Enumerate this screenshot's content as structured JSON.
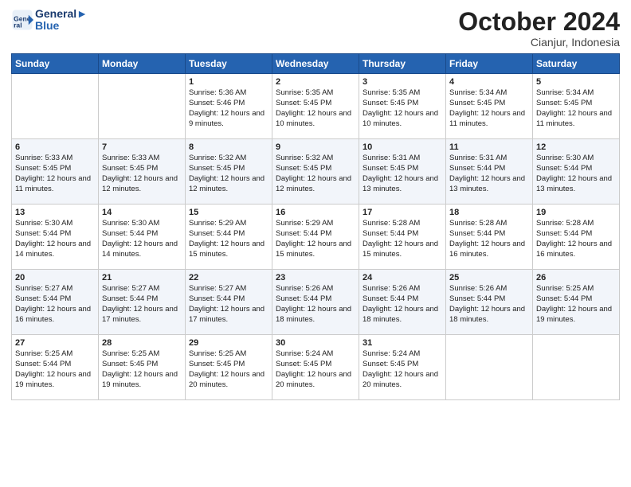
{
  "header": {
    "logo_line1": "General",
    "logo_line2": "Blue",
    "month": "October 2024",
    "location": "Cianjur, Indonesia"
  },
  "days_of_week": [
    "Sunday",
    "Monday",
    "Tuesday",
    "Wednesday",
    "Thursday",
    "Friday",
    "Saturday"
  ],
  "weeks": [
    [
      {
        "day": "",
        "sunrise": "",
        "sunset": "",
        "daylight": ""
      },
      {
        "day": "",
        "sunrise": "",
        "sunset": "",
        "daylight": ""
      },
      {
        "day": "1",
        "sunrise": "Sunrise: 5:36 AM",
        "sunset": "Sunset: 5:46 PM",
        "daylight": "Daylight: 12 hours and 9 minutes."
      },
      {
        "day": "2",
        "sunrise": "Sunrise: 5:35 AM",
        "sunset": "Sunset: 5:45 PM",
        "daylight": "Daylight: 12 hours and 10 minutes."
      },
      {
        "day": "3",
        "sunrise": "Sunrise: 5:35 AM",
        "sunset": "Sunset: 5:45 PM",
        "daylight": "Daylight: 12 hours and 10 minutes."
      },
      {
        "day": "4",
        "sunrise": "Sunrise: 5:34 AM",
        "sunset": "Sunset: 5:45 PM",
        "daylight": "Daylight: 12 hours and 11 minutes."
      },
      {
        "day": "5",
        "sunrise": "Sunrise: 5:34 AM",
        "sunset": "Sunset: 5:45 PM",
        "daylight": "Daylight: 12 hours and 11 minutes."
      }
    ],
    [
      {
        "day": "6",
        "sunrise": "Sunrise: 5:33 AM",
        "sunset": "Sunset: 5:45 PM",
        "daylight": "Daylight: 12 hours and 11 minutes."
      },
      {
        "day": "7",
        "sunrise": "Sunrise: 5:33 AM",
        "sunset": "Sunset: 5:45 PM",
        "daylight": "Daylight: 12 hours and 12 minutes."
      },
      {
        "day": "8",
        "sunrise": "Sunrise: 5:32 AM",
        "sunset": "Sunset: 5:45 PM",
        "daylight": "Daylight: 12 hours and 12 minutes."
      },
      {
        "day": "9",
        "sunrise": "Sunrise: 5:32 AM",
        "sunset": "Sunset: 5:45 PM",
        "daylight": "Daylight: 12 hours and 12 minutes."
      },
      {
        "day": "10",
        "sunrise": "Sunrise: 5:31 AM",
        "sunset": "Sunset: 5:45 PM",
        "daylight": "Daylight: 12 hours and 13 minutes."
      },
      {
        "day": "11",
        "sunrise": "Sunrise: 5:31 AM",
        "sunset": "Sunset: 5:44 PM",
        "daylight": "Daylight: 12 hours and 13 minutes."
      },
      {
        "day": "12",
        "sunrise": "Sunrise: 5:30 AM",
        "sunset": "Sunset: 5:44 PM",
        "daylight": "Daylight: 12 hours and 13 minutes."
      }
    ],
    [
      {
        "day": "13",
        "sunrise": "Sunrise: 5:30 AM",
        "sunset": "Sunset: 5:44 PM",
        "daylight": "Daylight: 12 hours and 14 minutes."
      },
      {
        "day": "14",
        "sunrise": "Sunrise: 5:30 AM",
        "sunset": "Sunset: 5:44 PM",
        "daylight": "Daylight: 12 hours and 14 minutes."
      },
      {
        "day": "15",
        "sunrise": "Sunrise: 5:29 AM",
        "sunset": "Sunset: 5:44 PM",
        "daylight": "Daylight: 12 hours and 15 minutes."
      },
      {
        "day": "16",
        "sunrise": "Sunrise: 5:29 AM",
        "sunset": "Sunset: 5:44 PM",
        "daylight": "Daylight: 12 hours and 15 minutes."
      },
      {
        "day": "17",
        "sunrise": "Sunrise: 5:28 AM",
        "sunset": "Sunset: 5:44 PM",
        "daylight": "Daylight: 12 hours and 15 minutes."
      },
      {
        "day": "18",
        "sunrise": "Sunrise: 5:28 AM",
        "sunset": "Sunset: 5:44 PM",
        "daylight": "Daylight: 12 hours and 16 minutes."
      },
      {
        "day": "19",
        "sunrise": "Sunrise: 5:28 AM",
        "sunset": "Sunset: 5:44 PM",
        "daylight": "Daylight: 12 hours and 16 minutes."
      }
    ],
    [
      {
        "day": "20",
        "sunrise": "Sunrise: 5:27 AM",
        "sunset": "Sunset: 5:44 PM",
        "daylight": "Daylight: 12 hours and 16 minutes."
      },
      {
        "day": "21",
        "sunrise": "Sunrise: 5:27 AM",
        "sunset": "Sunset: 5:44 PM",
        "daylight": "Daylight: 12 hours and 17 minutes."
      },
      {
        "day": "22",
        "sunrise": "Sunrise: 5:27 AM",
        "sunset": "Sunset: 5:44 PM",
        "daylight": "Daylight: 12 hours and 17 minutes."
      },
      {
        "day": "23",
        "sunrise": "Sunrise: 5:26 AM",
        "sunset": "Sunset: 5:44 PM",
        "daylight": "Daylight: 12 hours and 18 minutes."
      },
      {
        "day": "24",
        "sunrise": "Sunrise: 5:26 AM",
        "sunset": "Sunset: 5:44 PM",
        "daylight": "Daylight: 12 hours and 18 minutes."
      },
      {
        "day": "25",
        "sunrise": "Sunrise: 5:26 AM",
        "sunset": "Sunset: 5:44 PM",
        "daylight": "Daylight: 12 hours and 18 minutes."
      },
      {
        "day": "26",
        "sunrise": "Sunrise: 5:25 AM",
        "sunset": "Sunset: 5:44 PM",
        "daylight": "Daylight: 12 hours and 19 minutes."
      }
    ],
    [
      {
        "day": "27",
        "sunrise": "Sunrise: 5:25 AM",
        "sunset": "Sunset: 5:44 PM",
        "daylight": "Daylight: 12 hours and 19 minutes."
      },
      {
        "day": "28",
        "sunrise": "Sunrise: 5:25 AM",
        "sunset": "Sunset: 5:45 PM",
        "daylight": "Daylight: 12 hours and 19 minutes."
      },
      {
        "day": "29",
        "sunrise": "Sunrise: 5:25 AM",
        "sunset": "Sunset: 5:45 PM",
        "daylight": "Daylight: 12 hours and 20 minutes."
      },
      {
        "day": "30",
        "sunrise": "Sunrise: 5:24 AM",
        "sunset": "Sunset: 5:45 PM",
        "daylight": "Daylight: 12 hours and 20 minutes."
      },
      {
        "day": "31",
        "sunrise": "Sunrise: 5:24 AM",
        "sunset": "Sunset: 5:45 PM",
        "daylight": "Daylight: 12 hours and 20 minutes."
      },
      {
        "day": "",
        "sunrise": "",
        "sunset": "",
        "daylight": ""
      },
      {
        "day": "",
        "sunrise": "",
        "sunset": "",
        "daylight": ""
      }
    ]
  ]
}
